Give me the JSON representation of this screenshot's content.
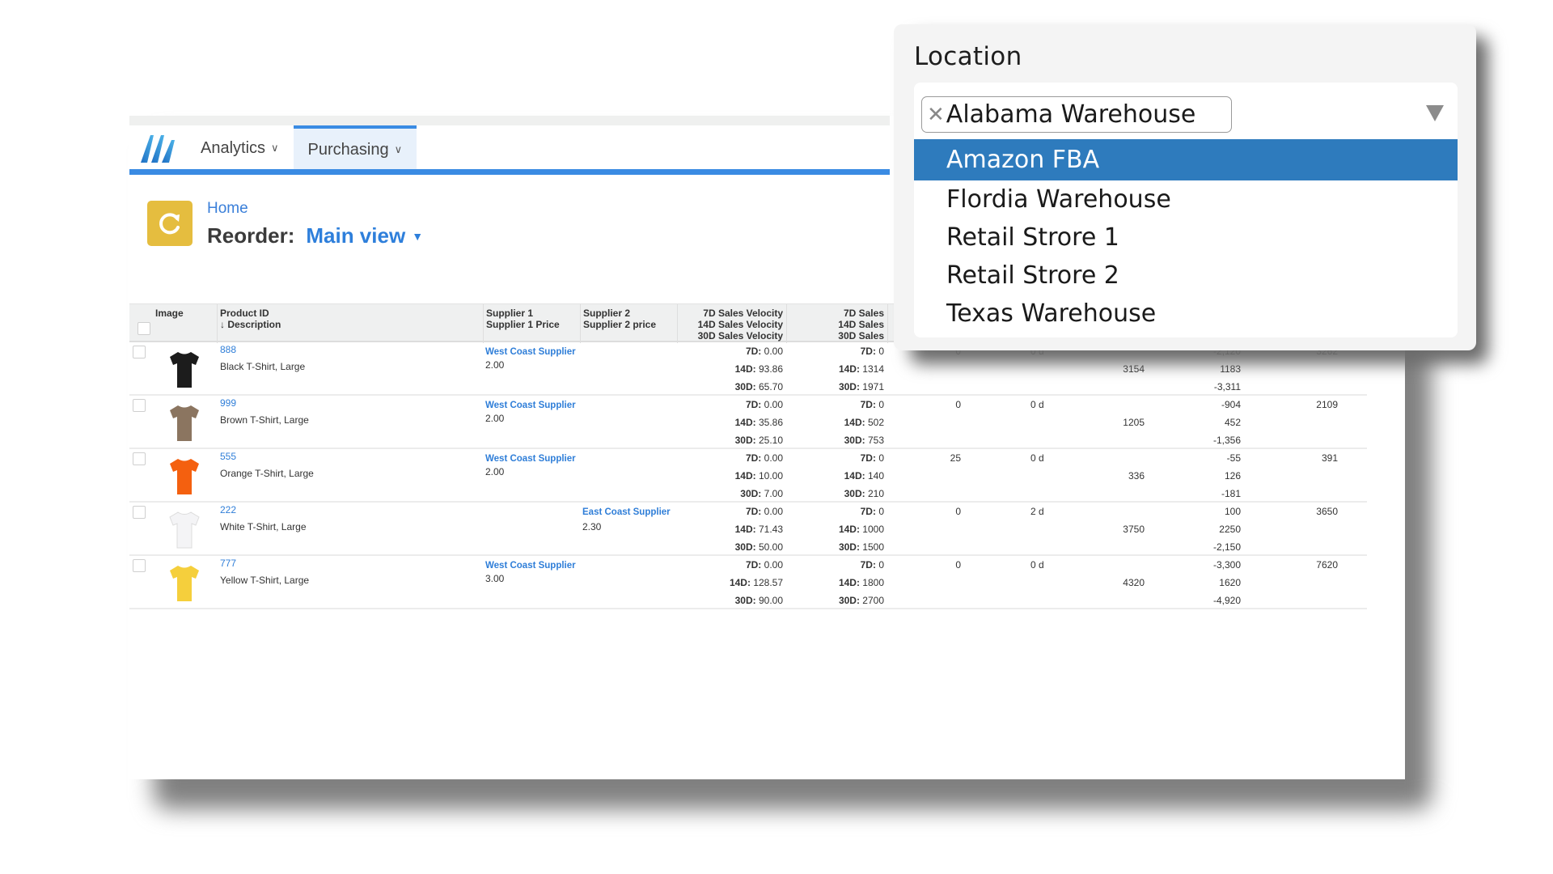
{
  "nav": {
    "items": [
      {
        "label": "Analytics",
        "active": false
      },
      {
        "label": "Purchasing",
        "active": true
      }
    ]
  },
  "header": {
    "breadcrumb": "Home",
    "title": "Reorder:",
    "view": "Main view"
  },
  "table": {
    "columns": {
      "image": "Image",
      "product_id": "Product ID",
      "description": "↓ Description",
      "supplier1": "Supplier 1",
      "supplier1_price": "Supplier 1 Price",
      "supplier2": "Supplier 2",
      "supplier2_price": "Supplier 2 price",
      "vel7": "7D Sales Velocity",
      "vel14": "14D Sales Velocity",
      "vel30": "30D Sales Velocity",
      "sales7": "7D Sales",
      "sales14": "14D Sales",
      "sales30": "30D Sales"
    },
    "rows": [
      {
        "id": "888",
        "description": "Black T-Shirt, Large",
        "shirt_color": "#1c1c1c",
        "supplier1": "West Coast Supplier",
        "supplier1_price": "2.00",
        "supplier2": "",
        "supplier2_price": "",
        "vel7": "0.00",
        "vel14": "93.86",
        "vel30": "65.70",
        "sales7": "0",
        "sales14": "1314",
        "sales30": "1971",
        "c1": "0",
        "c2": "0 d",
        "c3": "3154",
        "c4a": "-2,120",
        "c4b": "1183",
        "c4c": "-3,311",
        "c5": "3262"
      },
      {
        "id": "999",
        "description": "Brown T-Shirt, Large",
        "shirt_color": "#8b7560",
        "supplier1": "West Coast Supplier",
        "supplier1_price": "2.00",
        "supplier2": "",
        "supplier2_price": "",
        "vel7": "0.00",
        "vel14": "35.86",
        "vel30": "25.10",
        "sales7": "0",
        "sales14": "502",
        "sales30": "753",
        "c1": "0",
        "c2": "0 d",
        "c3": "1205",
        "c4a": "-904",
        "c4b": "452",
        "c4c": "-1,356",
        "c5": "2109"
      },
      {
        "id": "555",
        "description": "Orange T-Shirt, Large",
        "shirt_color": "#f4600f",
        "supplier1": "West Coast Supplier",
        "supplier1_price": "2.00",
        "supplier2": "",
        "supplier2_price": "",
        "vel7": "0.00",
        "vel14": "10.00",
        "vel30": "7.00",
        "sales7": "0",
        "sales14": "140",
        "sales30": "210",
        "c1": "25",
        "c2": "0 d",
        "c3": "336",
        "c4a": "-55",
        "c4b": "126",
        "c4c": "-181",
        "c5": "391"
      },
      {
        "id": "222",
        "description": "White T-Shirt, Large",
        "shirt_color": "#f4f4f6",
        "supplier1": "",
        "supplier1_price": "",
        "supplier2": "East Coast Supplier",
        "supplier2_price": "2.30",
        "vel7": "0.00",
        "vel14": "71.43",
        "vel30": "50.00",
        "sales7": "0",
        "sales14": "1000",
        "sales30": "1500",
        "c1": "0",
        "c2": "2 d",
        "c3": "3750",
        "c4a": "100",
        "c4b": "2250",
        "c4c": "-2,150",
        "c5": "3650"
      },
      {
        "id": "777",
        "description": "Yellow T-Shirt, Large",
        "shirt_color": "#f5cf3c",
        "supplier1": "West Coast Supplier",
        "supplier1_price": "3.00",
        "supplier2": "",
        "supplier2_price": "",
        "vel7": "0.00",
        "vel14": "128.57",
        "vel30": "90.00",
        "sales7": "0",
        "sales14": "1800",
        "sales30": "2700",
        "c1": "0",
        "c2": "0 d",
        "c3": "4320",
        "c4a": "-3,300",
        "c4b": "1620",
        "c4c": "-4,920",
        "c5": "7620"
      }
    ],
    "labels": {
      "d7": "7D:",
      "d14": "14D:",
      "d30": "30D:"
    }
  },
  "location_dropdown": {
    "label": "Location",
    "selected_value": "Alabama Warehouse",
    "options": [
      "Amazon FBA",
      "Flordia Warehouse",
      "Retail Strore 1",
      "Retail Strore 2",
      "Texas Warehouse"
    ],
    "highlighted_index": 0,
    "highlight_color": "#2e7bbd"
  },
  "colors": {
    "accent": "#3a8be3",
    "link": "#2f7ed8",
    "title_icon": "#e5bd3f"
  }
}
